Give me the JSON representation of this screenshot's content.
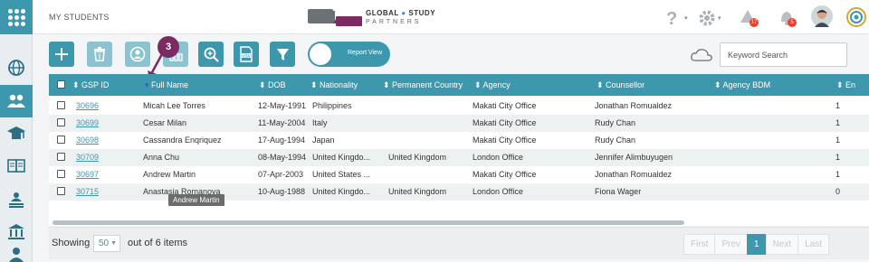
{
  "breadcrumb": "MY STUDENTS",
  "brand": {
    "line1_a": "GLOBAL",
    "line1_b": "STUDY",
    "line2": "PARTNERS"
  },
  "header_badges": {
    "alerts": "17",
    "notifications": "5"
  },
  "step_badge": "3",
  "toggle_label": "Report View",
  "search": {
    "placeholder": "Keyword Search",
    "value": ""
  },
  "columns": [
    "GSP ID",
    "Full Name",
    "DOB",
    "Nationality",
    "Permanent Country",
    "Agency",
    "Counsellor",
    "Agency BDM",
    "En"
  ],
  "rows": [
    {
      "id": "30696",
      "name": "Micah Lee Torres",
      "dob": "12-May-1991",
      "nationality": "Philippines",
      "perm": "",
      "agency": "Makati City Office",
      "counsellor": "Jonathan Romualdez",
      "bdm": "",
      "en": "1"
    },
    {
      "id": "30699",
      "name": "Cesar Milan",
      "dob": "11-May-2004",
      "nationality": "Italy",
      "perm": "",
      "agency": "Makati City Office",
      "counsellor": "Rudy Chan",
      "bdm": "",
      "en": "1"
    },
    {
      "id": "30698",
      "name": "Cassandra Enqriquez",
      "dob": "17-Aug-1994",
      "nationality": "Japan",
      "perm": "",
      "agency": "Makati City Office",
      "counsellor": "Rudy Chan",
      "bdm": "",
      "en": "1"
    },
    {
      "id": "30709",
      "name": "Anna Chu",
      "dob": "08-May-1994",
      "nationality": "United Kingdo...",
      "perm": "United Kingdom",
      "agency": "London Office",
      "counsellor": "Jennifer Alimbuyugen",
      "bdm": "",
      "en": "1"
    },
    {
      "id": "30697",
      "name": "Andrew Martin",
      "dob": "07-Apr-2003",
      "nationality": "United States ...",
      "perm": "",
      "agency": "Makati City Office",
      "counsellor": "Jonathan Romualdez",
      "bdm": "",
      "en": "1"
    },
    {
      "id": "30715",
      "name": "Anastasia Romanova",
      "dob": "10-Aug-1988",
      "nationality": "United Kingdo...",
      "perm": "United Kingdom",
      "agency": "London Office",
      "counsellor": "Fiona Wager",
      "bdm": "",
      "en": "0"
    }
  ],
  "tooltip": "Andrew Martin",
  "footer": {
    "showing": "Showing",
    "page_size": "50",
    "of_items": "out of 6 items",
    "pager": [
      "First",
      "Prev",
      "1",
      "Next",
      "Last"
    ]
  },
  "colors": {
    "accent": "#3d97ad",
    "brand_purple": "#7b2b61",
    "badge_red": "#e8412e"
  }
}
